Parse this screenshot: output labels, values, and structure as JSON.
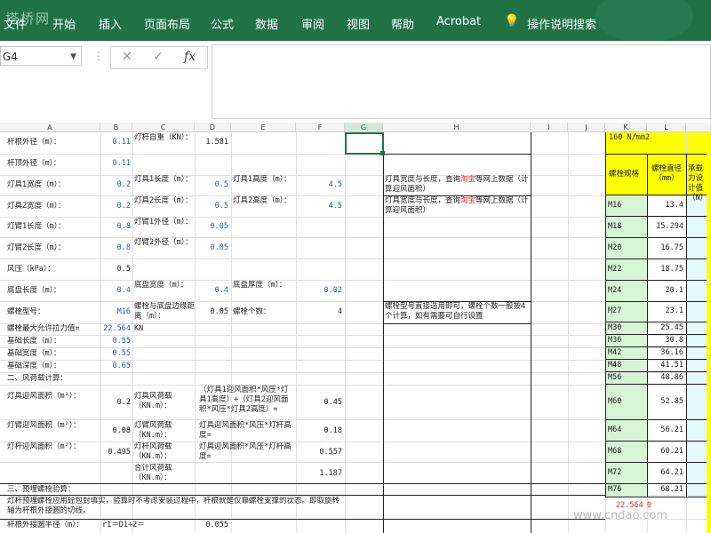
{
  "ribbon": {
    "tabs": [
      "文件",
      "开始",
      "插入",
      "页面布局",
      "公式",
      "数据",
      "审阅",
      "视图",
      "帮助",
      "Acrobat",
      "操作说明搜索"
    ],
    "watermark": "塔桥网"
  },
  "formula_bar": {
    "name_box": "G4",
    "cancel": "✕",
    "enter": "✓",
    "fx": "fx",
    "content": ""
  },
  "columns": [
    "A",
    "B",
    "C",
    "D",
    "E",
    "F",
    "G",
    "H",
    "I",
    "J",
    "K",
    "L"
  ],
  "selected_column": "G",
  "cells": {
    "r1": {
      "a": "杆根外径（m）：",
      "b": "0.11",
      "c": "灯杆自重（KN）：",
      "d": "1.581",
      "k": "160 N/mm2"
    },
    "r2": {
      "a": "杆顶外径（m）：",
      "b": "0.11",
      "k1": "螺栓规格",
      "k2": "螺栓直径（mm）",
      "k3": "承载力设计值（N）"
    },
    "r3": {
      "a": "灯具1宽度（m）：",
      "b": "0.2",
      "c": "灯具1长度（m）：",
      "d": "0.5",
      "e": "灯具1高度（m）：",
      "f": "4.5",
      "h": "灯具宽度与长度，查询淘宝等网上数据（计算迎风面积）",
      "h_red": "淘宝"
    },
    "r4": {
      "a": "灯具2宽度（m）：",
      "b": "0.2",
      "c": "灯具2长度（m）：",
      "d": "0.5",
      "e": "灯具2高度（m）：",
      "f": "4.5",
      "h": "灯具宽度与长度，查询淘宝等网上数据（计算迎风面积）",
      "h_red": "淘宝"
    },
    "r5": {
      "a": "灯臂1长度（m）：",
      "b": "0.8",
      "c": "灯臂1外径（m）：",
      "d": "0.05"
    },
    "r6": {
      "a": "灯臂2长度（m）：",
      "b": "0.8",
      "c": "灯臂2外径（m）：",
      "d": "0.05"
    },
    "r7": {
      "a": "风压（kPa）：",
      "b": "0.5"
    },
    "r8": {
      "a": "底盘长度（m）：",
      "b": "0.4",
      "c": "底盘宽度（m）：",
      "d": "0.4",
      "e": "底盘厚度（m）：",
      "f": "0.02"
    },
    "r9": {
      "a": "螺栓型号：",
      "b": "M16",
      "c": "螺栓与底盘边缘距离（m）：",
      "d": "0.05",
      "e": "螺栓个数：",
      "f": "4",
      "h": "螺栓型号直接选用即可，螺栓个数一般按4个计算，如有需要可自行设置"
    },
    "r10": {
      "a": "螺栓最大允许拉力值=",
      "b": "22.564",
      "c": "KN"
    },
    "r11": {
      "a": "基础长度（m）：",
      "b": "0.55"
    },
    "r12": {
      "a": "基础宽度（m）：",
      "b": "0.55"
    },
    "r13": {
      "a": "基础深度（m）：",
      "b": "0.65"
    },
    "r14": {
      "a": "二、风荷载计算："
    },
    "r15": {
      "a": "灯具迎风面积（m²）：",
      "b": "0.2",
      "c": "灯具风荷载（KN.m）：",
      "e": "（灯具1迎风面积*风压*灯具1高度）+（灯具2迎风面积*风压*灯具2高度）=",
      "f": "0.45"
    },
    "r16": {
      "a": "灯臂迎风面积（m²）：",
      "b": "0.08",
      "c": "灯臂风荷载（KN.m）：",
      "e": "灯具迎风面积*风压*灯杆高度=",
      "f": "0.18"
    },
    "r17": {
      "a": "灯杆迎风面积（m²）：",
      "b": "0.495",
      "c": "灯杆风荷载（KN.m）：",
      "e": "灯具迎风面积*风压*灯杆高度=",
      "f": "0.557"
    },
    "r18": {
      "c": "合计风荷载（KN.m）：",
      "f": "1.187"
    },
    "r19": {
      "a": "三、预埋螺栓验算："
    },
    "r20": {
      "a": "灯杆预埋螺栓应用砼包封填实，验算时不考虑安装过程中，杆根就是仅靠螺栓支撑的状态。即取旋转轴为杆根外接圆的切线。"
    },
    "r21": {
      "a": "杆根外接圆半径（m）：",
      "b": "r1＝D1÷2＝",
      "d": "0.055"
    },
    "k_footer": {
      "val": "22.564",
      "zero": "0"
    }
  },
  "bolts": [
    {
      "spec": "M16",
      "dia": "13.4"
    },
    {
      "spec": "M18",
      "dia": "15.294"
    },
    {
      "spec": "M20",
      "dia": "16.75"
    },
    {
      "spec": "M22",
      "dia": "18.75"
    },
    {
      "spec": "M24",
      "dia": "20.1"
    },
    {
      "spec": "M27",
      "dia": "23.1"
    },
    {
      "spec": "M30",
      "dia": "25.45"
    },
    {
      "spec": "M36",
      "dia": "30.8"
    },
    {
      "spec": "M42",
      "dia": "36.16"
    },
    {
      "spec": "M48",
      "dia": "41.51"
    },
    {
      "spec": "M56",
      "dia": "48.86"
    },
    {
      "spec": "M60",
      "dia": "52.85"
    },
    {
      "spec": "M64",
      "dia": "56.21"
    },
    {
      "spec": "M68",
      "dia": "60.21"
    },
    {
      "spec": "M72",
      "dia": "64.21"
    },
    {
      "spec": "M76",
      "dia": "68.21"
    }
  ],
  "site_watermark": "www.cndao.com",
  "colors": {
    "ribbon": "#217346",
    "yellow": "#ffff00",
    "green_fill": "#d7f5d4",
    "cyan_fill": "#e3f8ff",
    "blue_value": "#1f5fbf",
    "red": "#e0251c"
  }
}
